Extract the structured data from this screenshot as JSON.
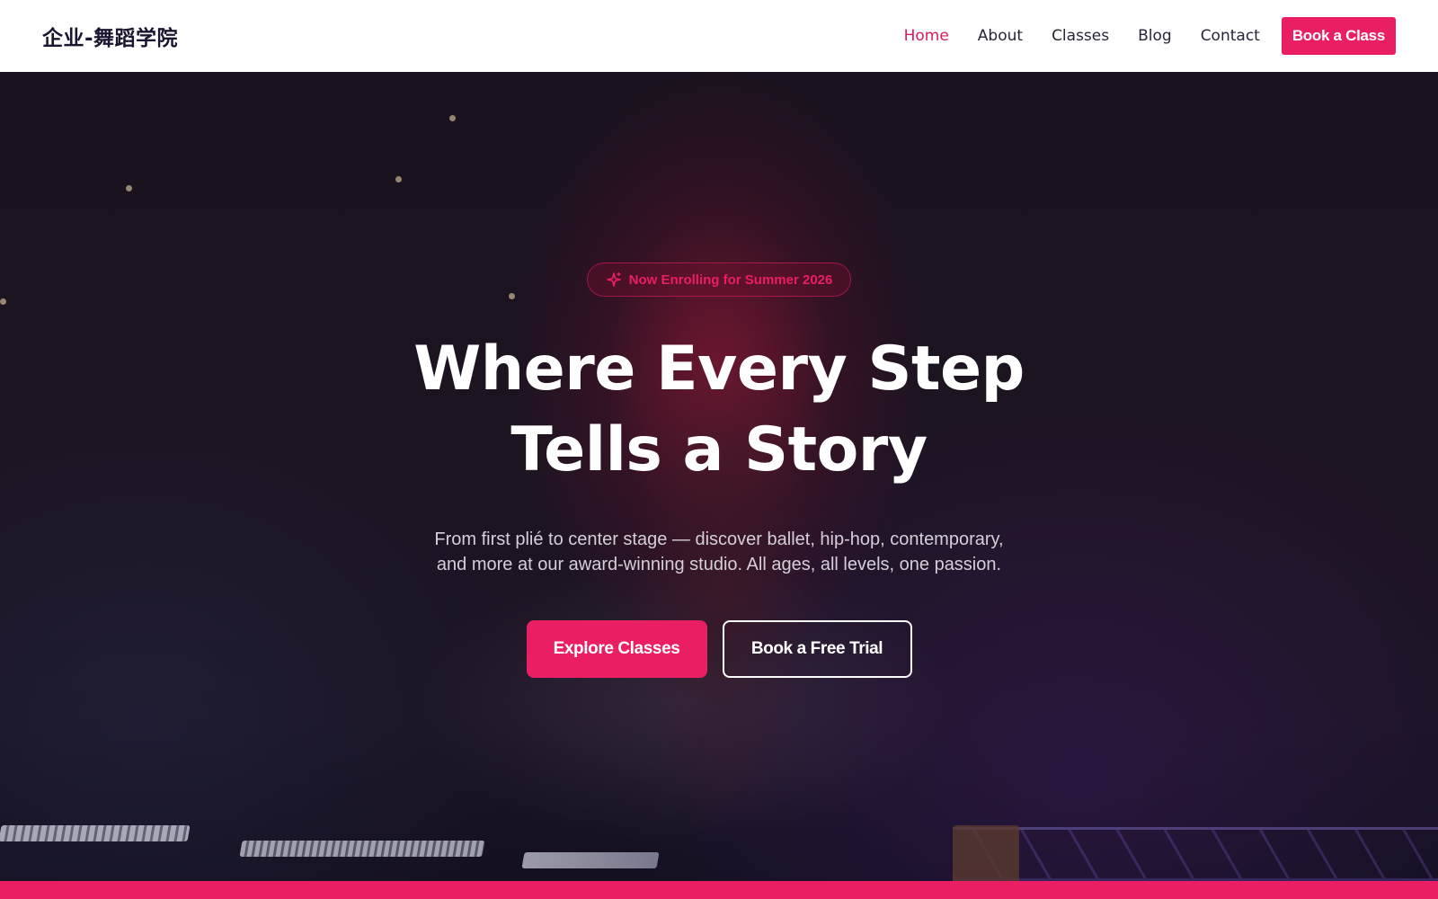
{
  "header": {
    "logo": "企业-舞蹈学院",
    "nav": [
      {
        "label": "Home",
        "active": true
      },
      {
        "label": "About",
        "active": false
      },
      {
        "label": "Classes",
        "active": false
      },
      {
        "label": "Blog",
        "active": false
      },
      {
        "label": "Contact",
        "active": false
      }
    ],
    "cta_label": "Book a Class"
  },
  "hero": {
    "badge_icon": "sparkles-icon",
    "badge_text": "Now Enrolling for Summer 2026",
    "headline_line1": "Where Every Step",
    "headline_line2": "Tells a Story",
    "subtitle": "From first plié to center stage — discover ballet, hip-hop, contemporary, and more at our award-winning studio. All ages, all levels, one passion.",
    "primary_button": "Explore Classes",
    "secondary_button": "Book a Free Trial"
  },
  "colors": {
    "accent": "#e91e63",
    "header_bg": "#ffffff",
    "hero_bg": "#1a121e",
    "text_dark": "#1c1530"
  }
}
